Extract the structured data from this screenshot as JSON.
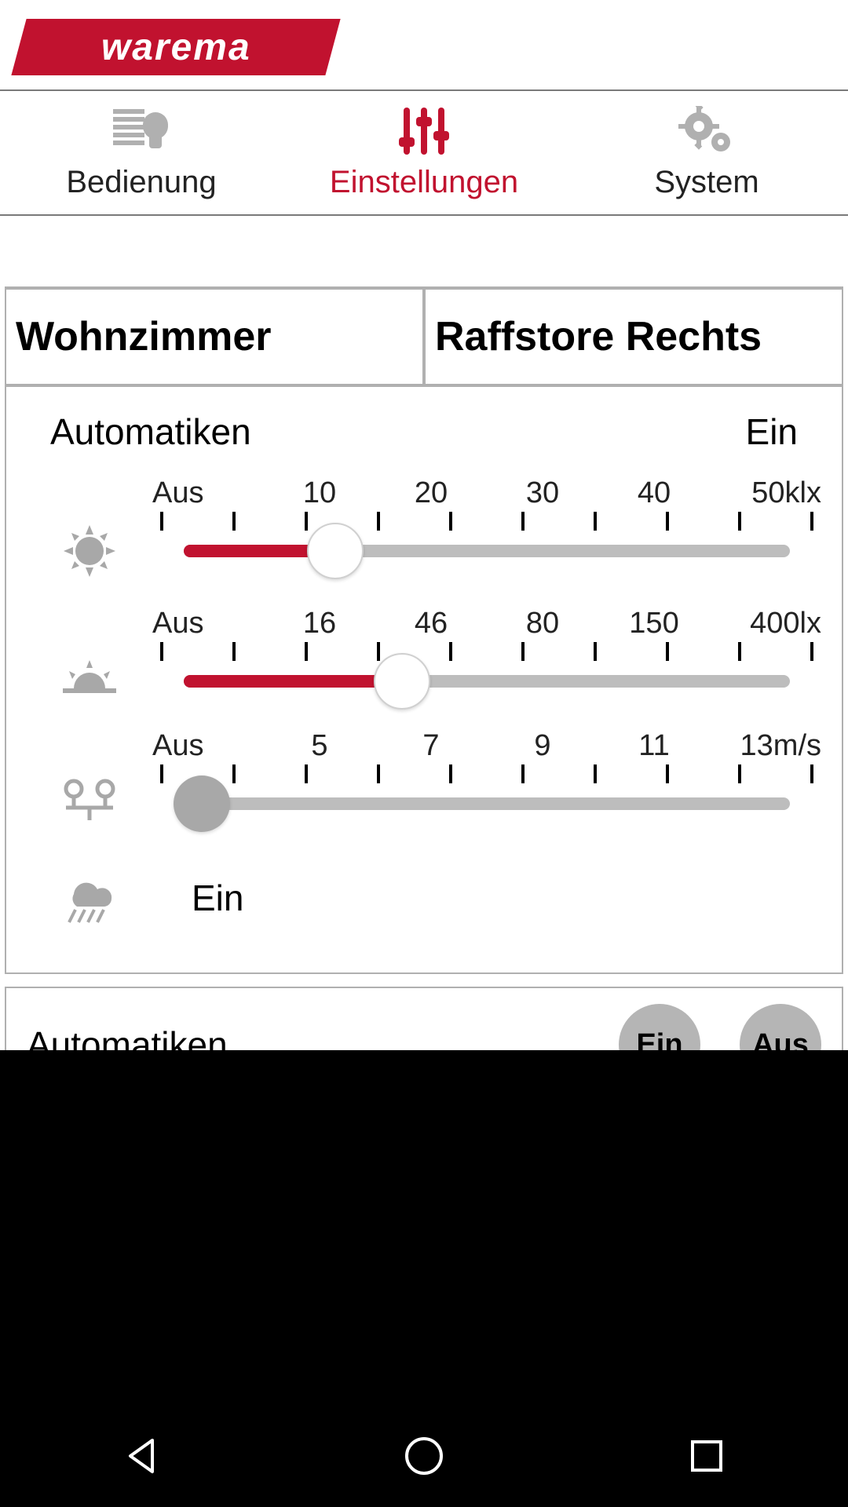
{
  "brand": "warema",
  "nav": {
    "items": [
      {
        "label": "Bedienung",
        "icon": "blinds-bulb-icon",
        "active": false
      },
      {
        "label": "Einstellungen",
        "icon": "sliders-icon",
        "active": true
      },
      {
        "label": "System",
        "icon": "gears-icon",
        "active": false
      }
    ]
  },
  "context": {
    "room": "Wohnzimmer",
    "device": "Raffstore Rechts"
  },
  "section": {
    "title": "Automatiken",
    "state": "Ein"
  },
  "sliders": {
    "sun": {
      "icon": "sun-icon",
      "labels": [
        "Aus",
        "10",
        "20",
        "30",
        "40",
        "50klx"
      ],
      "ticks": 10,
      "value_pct": 25,
      "thumb_style": "white"
    },
    "dusk": {
      "icon": "sunset-icon",
      "labels": [
        "Aus",
        "16",
        "46",
        "80",
        "150",
        "400lx"
      ],
      "ticks": 10,
      "value_pct": 36,
      "thumb_style": "white"
    },
    "wind": {
      "icon": "anemometer-icon",
      "labels": [
        "Aus",
        "5",
        "7",
        "9",
        "11",
        "13m/s"
      ],
      "ticks": 10,
      "value_pct": 3,
      "thumb_style": "grey"
    }
  },
  "rain": {
    "icon": "rain-icon",
    "state": "Ein"
  },
  "bottom": {
    "title": "Automatiken",
    "on_label": "Ein",
    "off_label": "Aus"
  },
  "colors": {
    "accent": "#c1122f",
    "grey": "#b5b5b5"
  }
}
